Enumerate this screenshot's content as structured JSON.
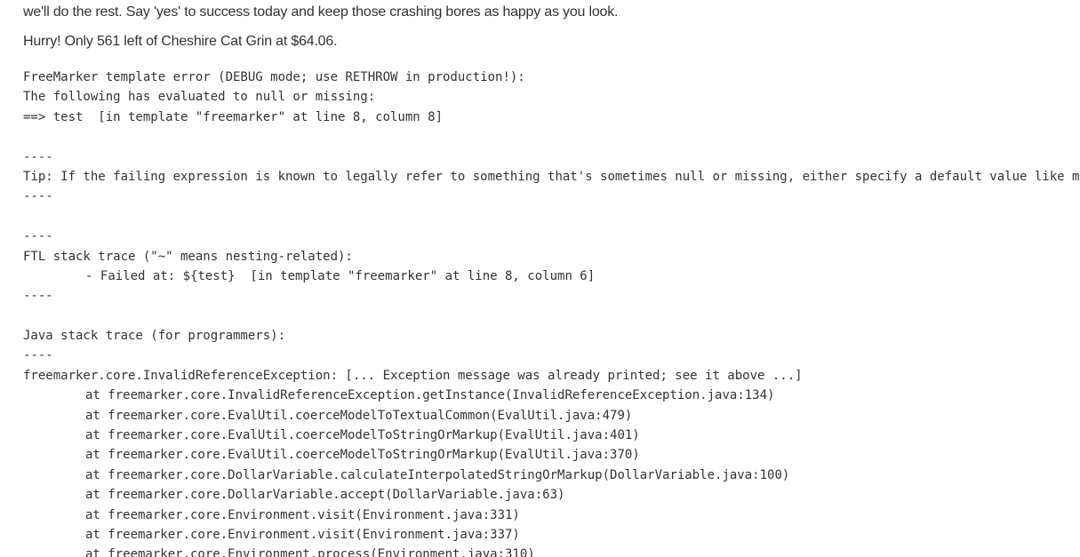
{
  "intro_text": "we'll do the rest. Say 'yes' to success today and keep those crashing bores as happy as you look.",
  "hurry_text": "Hurry! Only 561 left of Cheshire Cat Grin at $64.06.",
  "error": {
    "header": "FreeMarker template error (DEBUG mode; use RETHROW in production!):",
    "evaluated": "The following has evaluated to null or missing:",
    "expression": "==> test  [in template \"freemarker\" at line 8, column 8]",
    "separator": "----",
    "tip": "Tip: If the failing expression is known to legally refer to something that's sometimes null or missing, either specify a default value like myOptionalVar!myDefault, or use <#if myOptionalVar??>when-present<#else>when-missing</#if>.",
    "ftl_header": "FTL stack trace (\"~\" means nesting-related):",
    "ftl_failed": "- Failed at: ${test}  [in template \"freemarker\" at line 8, column 6]",
    "java_header": "Java stack trace (for programmers):",
    "exception": "freemarker.core.InvalidReferenceException: [... Exception message was already printed; see it above ...]",
    "stack": [
      "at freemarker.core.InvalidReferenceException.getInstance(InvalidReferenceException.java:134)",
      "at freemarker.core.EvalUtil.coerceModelToTextualCommon(EvalUtil.java:479)",
      "at freemarker.core.EvalUtil.coerceModelToStringOrMarkup(EvalUtil.java:401)",
      "at freemarker.core.EvalUtil.coerceModelToStringOrMarkup(EvalUtil.java:370)",
      "at freemarker.core.DollarVariable.calculateInterpolatedStringOrMarkup(DollarVariable.java:100)",
      "at freemarker.core.DollarVariable.accept(DollarVariable.java:63)",
      "at freemarker.core.Environment.visit(Environment.java:331)",
      "at freemarker.core.Environment.visit(Environment.java:337)",
      "at freemarker.core.Environment.process(Environment.java:310)"
    ]
  }
}
